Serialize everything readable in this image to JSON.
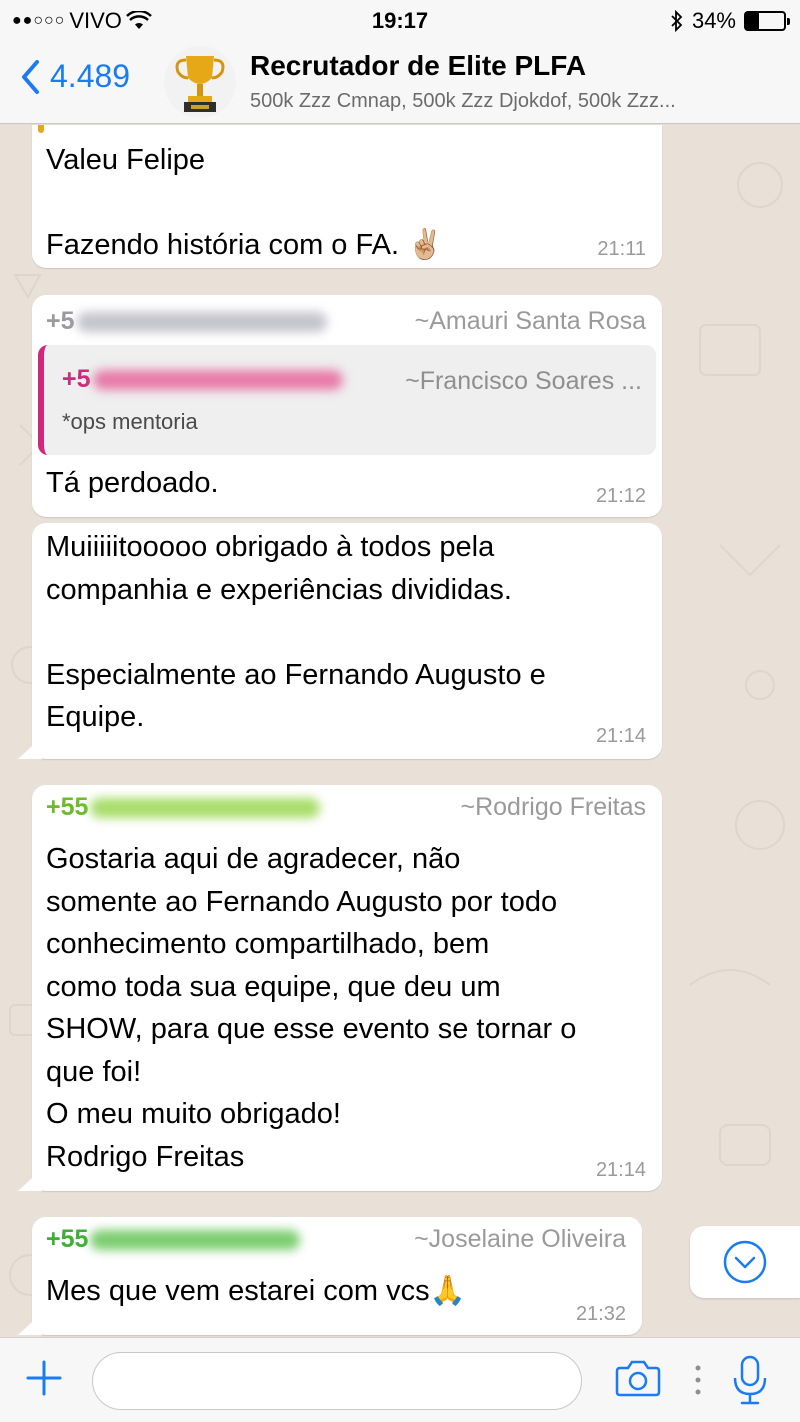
{
  "status_bar": {
    "carrier": "VIVO",
    "time": "19:17",
    "battery": "34%",
    "battery_level": 0.34
  },
  "header": {
    "back_count": "4.489",
    "title": "Recrutador de Elite PLFA",
    "members": "500k Zzz Cmnap, 500k Zzz Djokdof, 500k Zzz..."
  },
  "messages": [
    {
      "text": "Valeu Felipe\n\nFazendo história com o FA. ✌🏼",
      "time": "21:11"
    },
    {
      "phone": "+5",
      "sender": "~Amauri Santa Rosa",
      "quote": {
        "phone": "+5",
        "sender": "~Francisco Soares ...",
        "text": "*ops mentoria"
      },
      "text": "Tá perdoado.",
      "time": "21:12"
    },
    {
      "text": "Muiiiiitooooo obrigado à todos pela\ncompanhia e experiências divididas.\n\nEspecialmente ao Fernando Augusto e\nEquipe.",
      "time": "21:14"
    },
    {
      "phone": "+55",
      "sender": "~Rodrigo Freitas",
      "text": "Gostaria aqui de agradecer, não\nsomente ao Fernando Augusto por todo\nconhecimento compartilhado, bem\ncomo toda sua equipe, que deu um\nSHOW, para que esse evento se tornar o\nque foi!\nO meu muito obrigado!\nRodrigo Freitas",
      "time": "21:14"
    },
    {
      "phone": "+55",
      "sender": "~Joselaine Oliveira",
      "text": "Mes que vem estarei com vcs🙏",
      "time": "21:32"
    }
  ],
  "input": {
    "placeholder": ""
  },
  "colors": {
    "accent": "#1a7cf5",
    "sender_gray": "#9a9a9a",
    "sender_green": "#6dbb2a",
    "quote_pink": "#d0287a",
    "chat_bg": "#e9e1d8"
  },
  "icons": [
    "back-chevron-icon",
    "wifi-icon",
    "bluetooth-icon",
    "battery-icon",
    "trophy-icon",
    "plus-icon",
    "camera-icon",
    "more-icon",
    "microphone-icon",
    "scroll-down-icon"
  ]
}
